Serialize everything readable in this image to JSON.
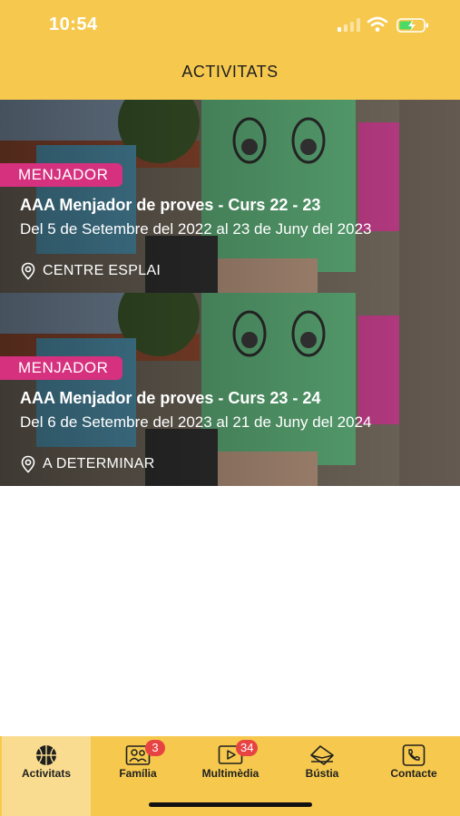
{
  "status_bar": {
    "time": "10:54"
  },
  "header": {
    "title": "ACTIVITATS"
  },
  "activities": [
    {
      "tag": "MENJADOR",
      "title": "AAA Menjador de proves - Curs 22 - 23",
      "dates": "Del 5 de Setembre del 2022 al 23 de Juny del 2023",
      "location": "CENTRE ESPLAI"
    },
    {
      "tag": "MENJADOR",
      "title": "AAA Menjador de proves - Curs 23 - 24",
      "dates": "Del 6 de Setembre del 2023 al 21 de Juny del 2024",
      "location": "A DETERMINAR"
    }
  ],
  "tabbar": {
    "items": [
      {
        "label": "Activitats",
        "icon": "basketball-icon",
        "active": true
      },
      {
        "label": "Família",
        "icon": "family-icon",
        "badge": "3"
      },
      {
        "label": "Multimèdia",
        "icon": "video-icon",
        "badge": "34"
      },
      {
        "label": "Bústia",
        "icon": "mailbox-icon"
      },
      {
        "label": "Contacte",
        "icon": "phone-icon"
      }
    ]
  },
  "colors": {
    "brand_yellow": "#f6c94e",
    "tag_pink": "#d6317f",
    "badge_red": "#e74343"
  }
}
